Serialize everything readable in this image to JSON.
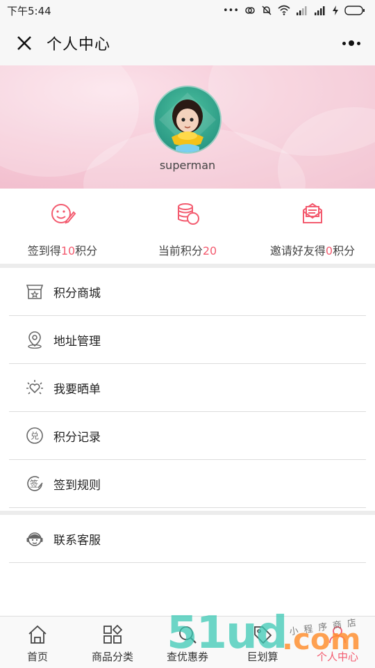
{
  "status_bar": {
    "time": "下午5:44",
    "dots": "•••"
  },
  "nav": {
    "title": "个人中心"
  },
  "profile": {
    "username": "superman"
  },
  "stats": [
    {
      "prefix": "签到得",
      "num": "10",
      "suffix": "积分",
      "icon": "smile-pen-icon"
    },
    {
      "prefix": "当前积分",
      "num": "20",
      "suffix": "",
      "icon": "coins-icon"
    },
    {
      "prefix": "邀请好友得",
      "num": "0",
      "suffix": "积分",
      "icon": "mail-icon"
    }
  ],
  "menu_group_1": [
    {
      "label": "积分商城",
      "icon": "shop-icon"
    },
    {
      "label": "地址管理",
      "icon": "location-icon"
    },
    {
      "label": "我要晒单",
      "icon": "sun-heart-icon"
    },
    {
      "label": "积分记录",
      "icon": "exchange-icon"
    },
    {
      "label": "签到规则",
      "icon": "sign-icon"
    }
  ],
  "menu_group_2": [
    {
      "label": "联系客服",
      "icon": "service-icon"
    }
  ],
  "tabs": [
    {
      "label": "首页",
      "icon": "home-icon",
      "active": false
    },
    {
      "label": "商品分类",
      "icon": "category-icon",
      "active": false
    },
    {
      "label": "查优惠券",
      "icon": "search-icon",
      "active": false
    },
    {
      "label": "巨划算",
      "icon": "tag-icon",
      "active": false
    },
    {
      "label": "个人中心",
      "icon": "user-icon",
      "active": true
    }
  ],
  "watermark": {
    "brand": "51ud",
    "domain": ".com",
    "tagline": "小程序商店"
  },
  "colors": {
    "accent": "#f35b6f",
    "banner": "#f6cbd8",
    "avatar_bg": "#2d9c86"
  }
}
